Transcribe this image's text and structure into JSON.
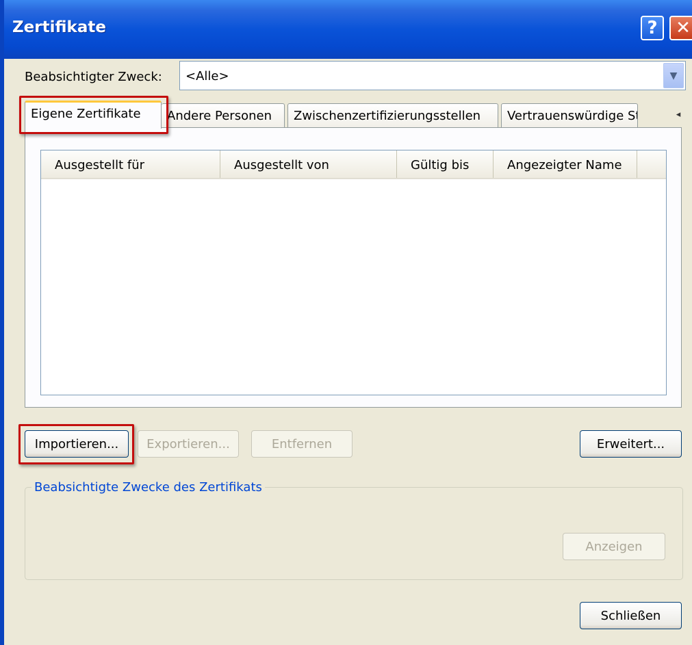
{
  "window": {
    "title": "Zertifikate",
    "help_button": "?",
    "close_button": "✕"
  },
  "purpose": {
    "label": "Beabsichtigter Zweck:",
    "value": "<Alle>"
  },
  "tabs": [
    {
      "label": "Eigene Zertifikate",
      "active": true
    },
    {
      "label": "Andere Personen",
      "active": false
    },
    {
      "label": "Zwischenzertifizierungsstellen",
      "active": false
    },
    {
      "label": "Vertrauenswürdige Stammzertifizierungsstellen",
      "active": false
    }
  ],
  "tab_scroll": {
    "left": "◂",
    "right": "▸"
  },
  "list": {
    "columns": [
      "Ausgestellt für",
      "Ausgestellt von",
      "Gültig bis",
      "Angezeigter Name"
    ],
    "rows": []
  },
  "buttons": {
    "import": "Importieren...",
    "export": "Exportieren...",
    "remove": "Entfernen",
    "advanced": "Erweitert...",
    "view": "Anzeigen",
    "close": "Schließen"
  },
  "purposes_group": {
    "title": "Beabsichtigte Zwecke des Zertifikats"
  },
  "colors": {
    "titlebar": "#0a53d8",
    "highlight": "#c40e0e",
    "group_title": "#0046d5"
  }
}
